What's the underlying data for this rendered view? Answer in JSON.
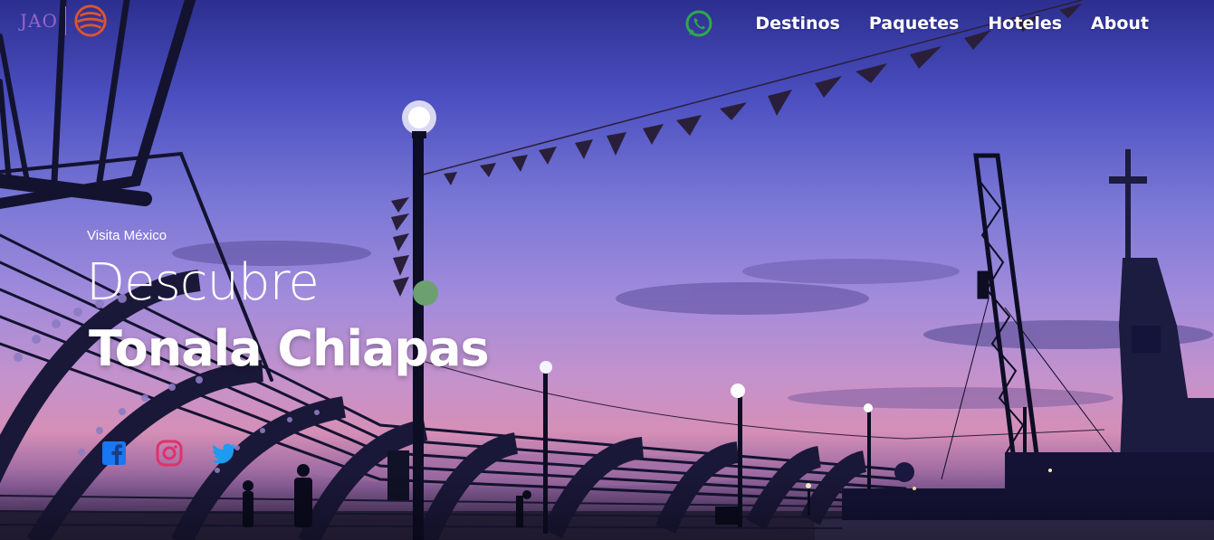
{
  "brand": {
    "name": "JAO",
    "logo_color": "#e0542b"
  },
  "nav": {
    "links": [
      {
        "label": "Destinos"
      },
      {
        "label": "Paquetes"
      },
      {
        "label": "Hoteles"
      },
      {
        "label": "About"
      }
    ],
    "whatsapp_icon": "whatsapp-icon",
    "whatsapp_color": "#2ea84a"
  },
  "hero": {
    "kicker": "Visita México",
    "title_light": "Descubre",
    "title_bold": "Tonala Chiapas",
    "background": "sunset-sky-promenade-photo"
  },
  "social": {
    "links": [
      {
        "icon": "facebook-icon",
        "color": "#1877f2"
      },
      {
        "icon": "instagram-icon",
        "color": "#e1306c"
      },
      {
        "icon": "twitter-icon",
        "color": "#1d9bf0"
      }
    ]
  }
}
